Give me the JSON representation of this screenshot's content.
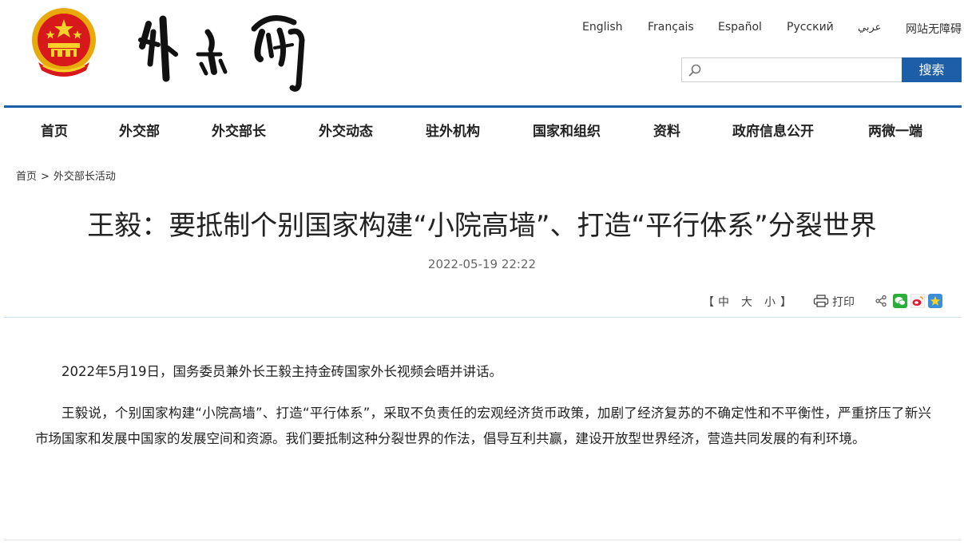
{
  "header": {
    "emblem_name": "national-emblem",
    "logo_name": "ministry-calligraphy-logo",
    "languages": [
      "English",
      "Français",
      "Español",
      "Русский",
      "عربي",
      "网站无障碍"
    ],
    "search": {
      "placeholder": "",
      "button_label": "搜索"
    }
  },
  "nav": {
    "items": [
      "首页",
      "外交部",
      "外交部长",
      "外交动态",
      "驻外机构",
      "国家和组织",
      "资料",
      "政府信息公开",
      "两微一端"
    ]
  },
  "breadcrumb": {
    "home": "首页",
    "separator": ">",
    "current": "外交部长活动"
  },
  "article": {
    "title": "王毅：要抵制个别国家构建“小院高墙”、打造“平行体系”分裂世界",
    "date": "2022-05-19 22:22",
    "font_size_label": "【 中  大  小 】",
    "font_sizes": [
      "中",
      "大",
      "小"
    ],
    "print_label": "打印",
    "share_icons": [
      "share-icon",
      "wechat-icon",
      "weibo-icon",
      "qzone-icon"
    ],
    "paragraphs": [
      "2022年5月19日，国务委员兼外长王毅主持金砖国家外长视频会晤并讲话。",
      "王毅说，个别国家构建“小院高墙”、打造“平行体系”，采取不负责任的宏观经济货币政策，加剧了经济复苏的不确定性和不平衡性，严重挤压了新兴市场国家和发展中国家的发展空间和资源。我们要抵制这种分裂世界的作法，倡导互利共赢，建设开放型世界经济，营造共同发展的有利环境。"
    ]
  },
  "colors": {
    "brand_blue": "#1c5ea8",
    "emblem_red": "#d7191c",
    "emblem_gold": "#f2b705"
  }
}
